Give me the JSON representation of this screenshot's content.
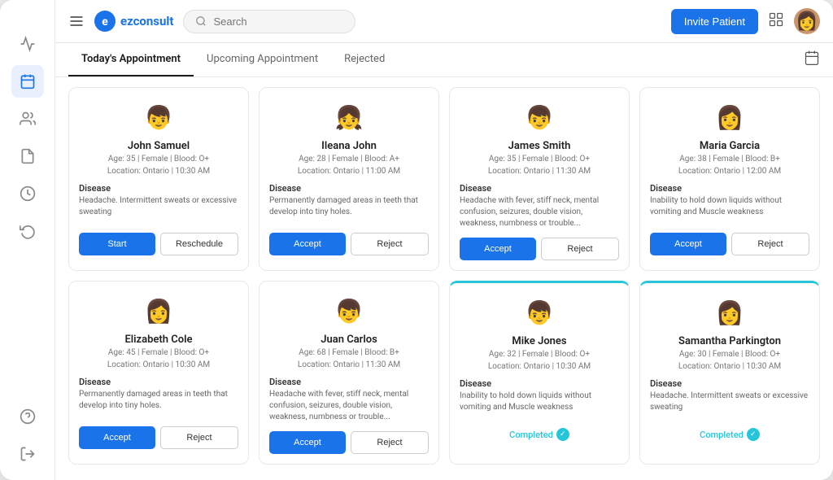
{
  "app": {
    "name": "ezconsult",
    "logo_text": "e"
  },
  "header": {
    "search_placeholder": "Search",
    "invite_btn": "Invite Patient"
  },
  "tabs": [
    {
      "id": "today",
      "label": "Today's Appointment",
      "active": true
    },
    {
      "id": "upcoming",
      "label": "Upcoming Appointment",
      "active": false
    },
    {
      "id": "rejected",
      "label": "Rejected",
      "active": false
    }
  ],
  "sidebar": {
    "items": [
      {
        "id": "activity",
        "icon": "⚡",
        "active": false
      },
      {
        "id": "calendar",
        "icon": "📅",
        "active": true
      },
      {
        "id": "people",
        "icon": "👤",
        "active": false
      },
      {
        "id": "document",
        "icon": "📄",
        "active": false
      },
      {
        "id": "clock",
        "icon": "🕐",
        "active": false
      },
      {
        "id": "history",
        "icon": "🕑",
        "active": false
      }
    ],
    "bottom": [
      {
        "id": "help",
        "icon": "❓"
      },
      {
        "id": "logout",
        "icon": "→"
      }
    ]
  },
  "row1": [
    {
      "id": "john-samuel",
      "emoji": "👦",
      "name": "John Samuel",
      "age": "Age: 35 | Female | Blood: O+",
      "location": "Location: Ontario | 10:30 AM",
      "disease_label": "Disease",
      "disease": "Headache. Intermittent sweats or excessive sweating",
      "buttons": [
        "start",
        "reschedule"
      ],
      "completed": false
    },
    {
      "id": "ileana-john",
      "emoji": "👧",
      "name": "Ileana John",
      "age": "Age: 28 | Female | Blood: A+",
      "location": "Location: Ontario | 11:00 AM",
      "disease_label": "Disease",
      "disease": "Permanently damaged areas in teeth that develop into tiny holes.",
      "buttons": [
        "accept",
        "reject"
      ],
      "completed": false
    },
    {
      "id": "james-smith",
      "emoji": "👦",
      "name": "James Smith",
      "age": "Age: 35 | Female | Blood: O+",
      "location": "Location: Ontario | 11:30 AM",
      "disease_label": "Disease",
      "disease": "Headache with fever, stiff neck, mental confusion, seizures, double vision, weakness, numbness or trouble...",
      "buttons": [
        "accept",
        "reject"
      ],
      "completed": false
    },
    {
      "id": "maria-garcia",
      "emoji": "👩",
      "name": "Maria Garcia",
      "age": "Age: 38 | Female | Blood: B+",
      "location": "Location: Ontario | 12:00 AM",
      "disease_label": "Disease",
      "disease": "Inability to hold down liquids without vomiting and Muscle weakness",
      "buttons": [
        "accept",
        "reject"
      ],
      "completed": false
    }
  ],
  "row2": [
    {
      "id": "elizabeth-cole",
      "emoji": "👩",
      "name": "Elizabeth Cole",
      "age": "Age: 45 | Female | Blood: O+",
      "location": "Location: Ontario | 10:30 AM",
      "disease_label": "Disease",
      "disease": "Permanently damaged areas in teeth that develop into tiny holes.",
      "buttons": [
        "accept",
        "reject"
      ],
      "completed": false,
      "border_top": false
    },
    {
      "id": "juan-carlos",
      "emoji": "👦",
      "name": "Juan Carlos",
      "age": "Age: 68 | Female | Blood: B+",
      "location": "Location: Ontario | 11:30 AM",
      "disease_label": "Disease",
      "disease": "Headache with fever, stiff neck, mental confusion, seizures, double vision, weakness, numbness or trouble...",
      "buttons": [
        "accept",
        "reject"
      ],
      "completed": false,
      "border_top": false
    },
    {
      "id": "mike-jones",
      "emoji": "👦",
      "name": "Mike Jones",
      "age": "Age: 32 | Female | Blood: O+",
      "location": "Location: Ontario | 10:30 AM",
      "disease_label": "Disease",
      "disease": "Inability to hold down liquids without vomiting and Muscle weakness",
      "buttons": [],
      "completed": true,
      "completed_label": "Completed",
      "border_top": true
    },
    {
      "id": "samantha-parkington",
      "emoji": "👩",
      "name": "Samantha Parkington",
      "age": "Age: 30 | Female | Blood: O+",
      "location": "Location: Ontario | 10:30 AM",
      "disease_label": "Disease",
      "disease": "Headache. Intermittent sweats or excessive sweating",
      "buttons": [],
      "completed": true,
      "completed_label": "Completed",
      "border_top": true
    }
  ],
  "buttons": {
    "start": "Start",
    "reschedule": "Reschedule",
    "accept": "Accept",
    "reject": "Reject"
  }
}
